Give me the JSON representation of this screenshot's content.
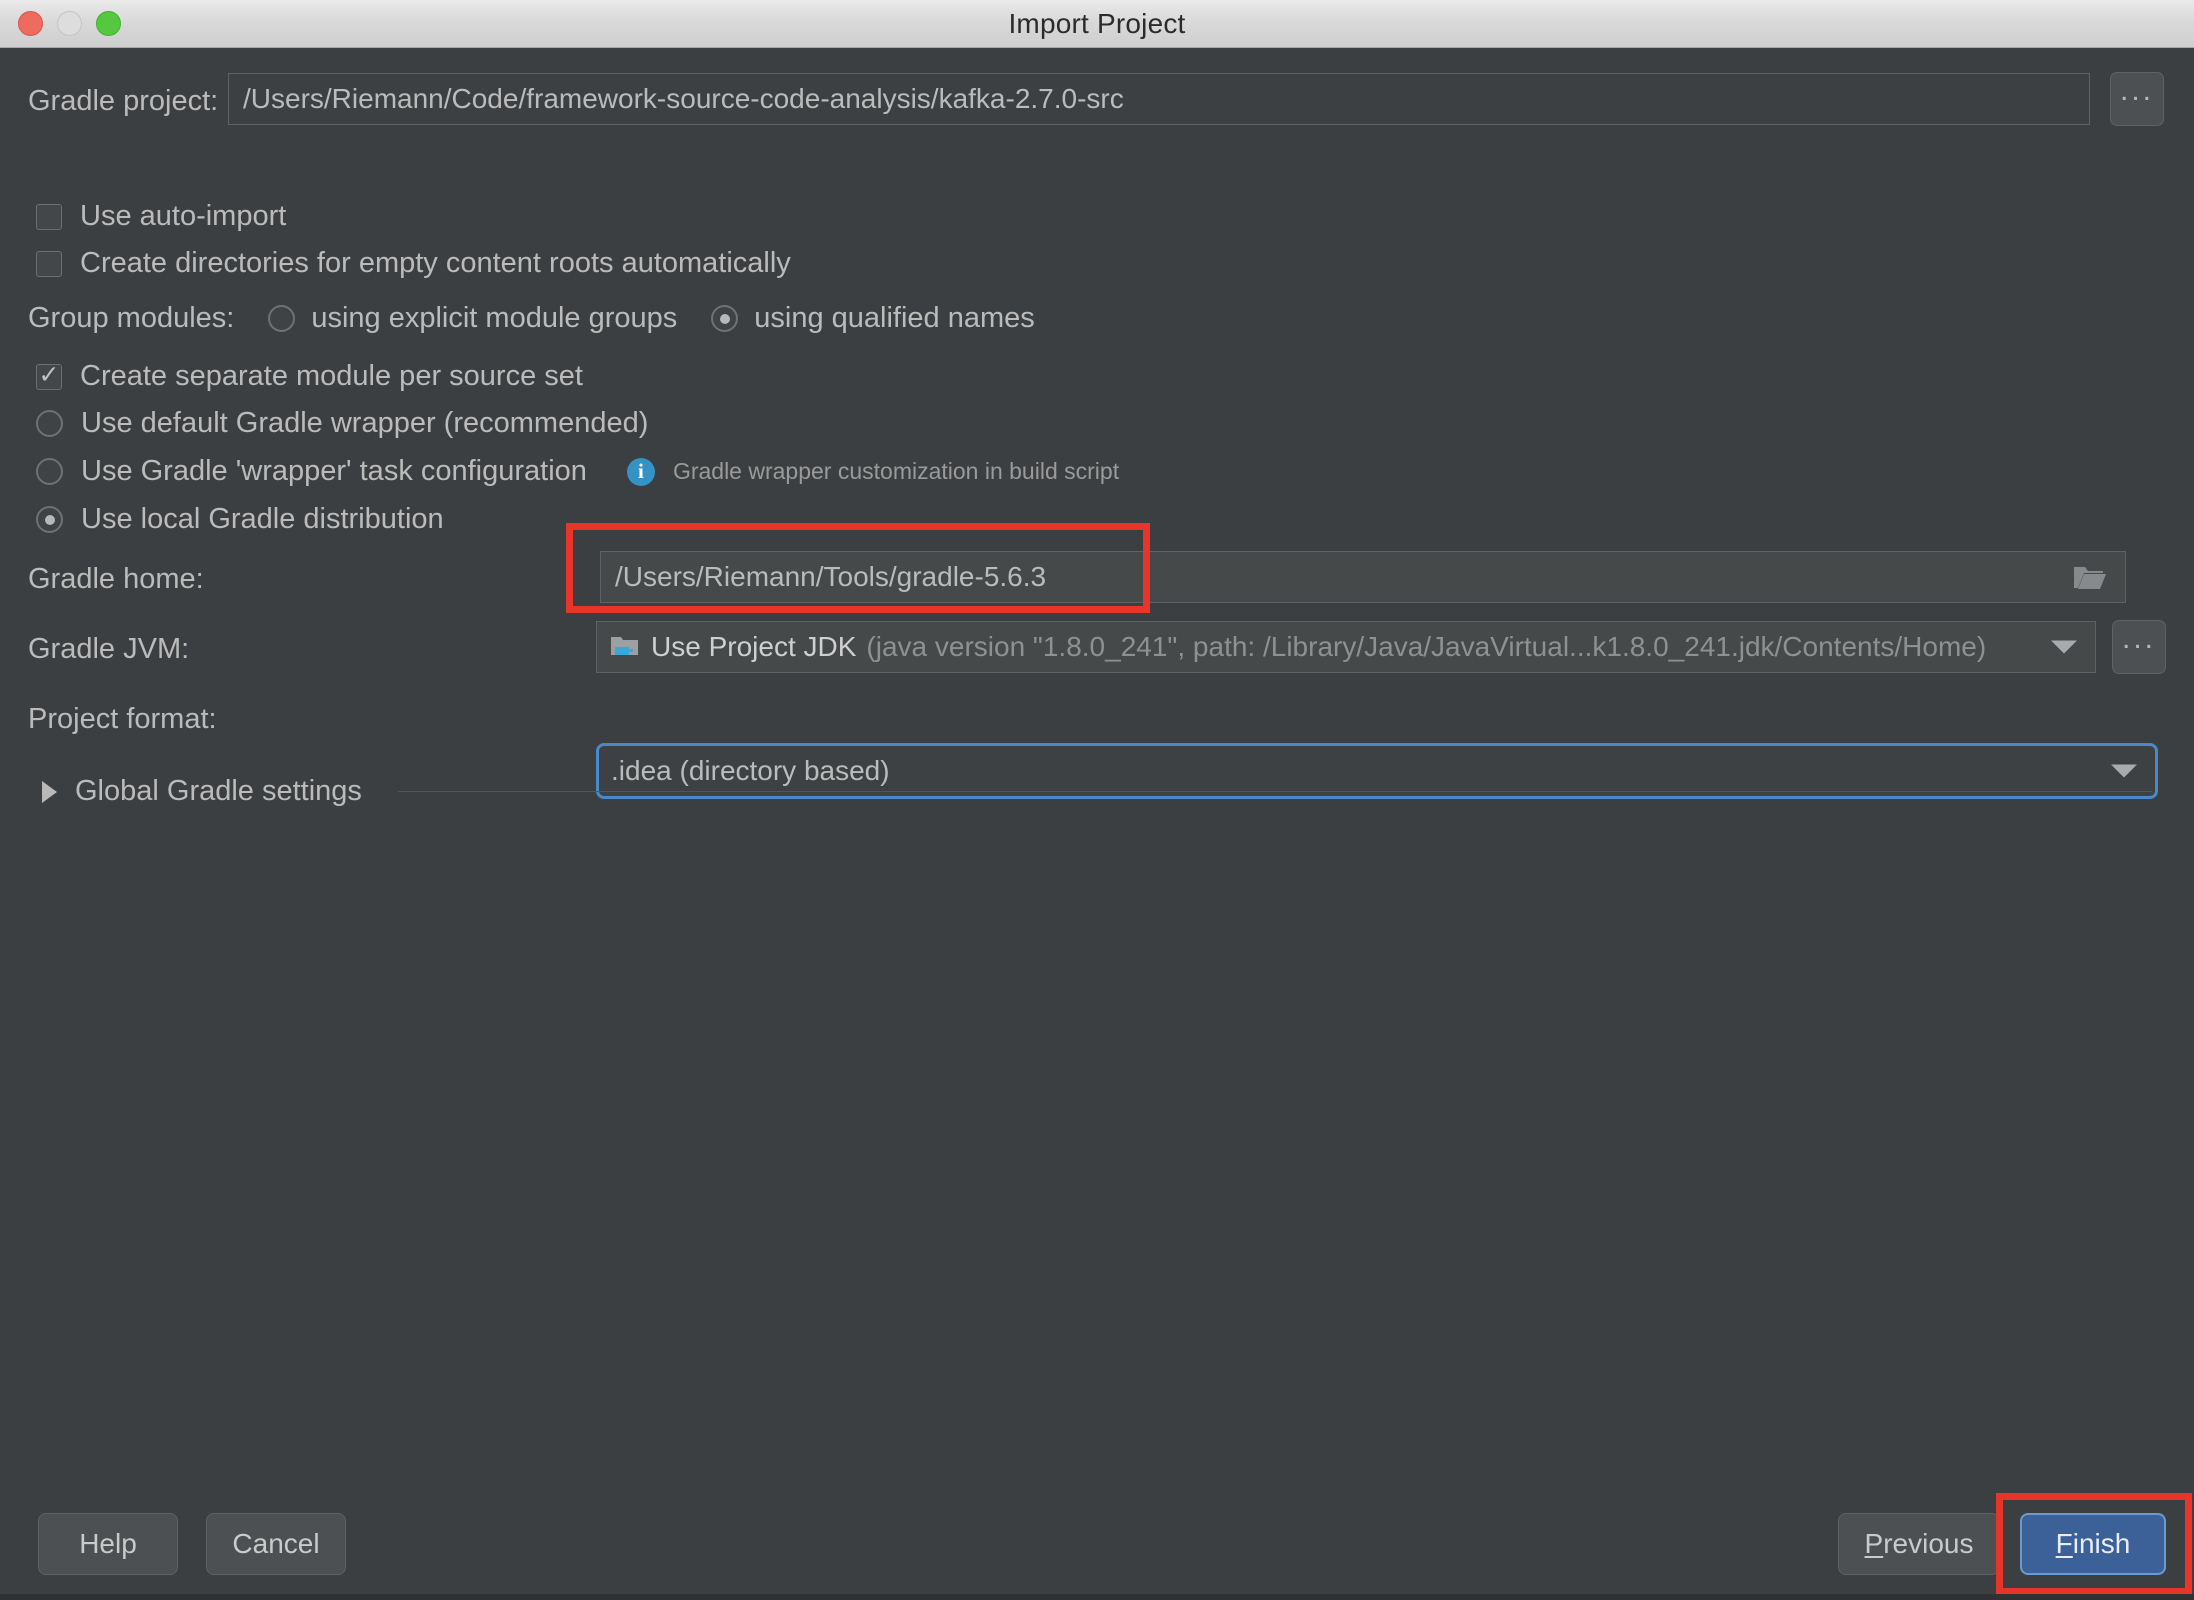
{
  "window": {
    "title": "Import Project",
    "traffic_lights": [
      "close-button",
      "minimize-button",
      "zoom-button"
    ]
  },
  "form": {
    "gradle_project": {
      "label": "Gradle project:",
      "value": "/Users/Riemann/Code/framework-source-code-analysis/kafka-2.7.0-src",
      "browse_label": "..."
    },
    "use_auto_import": {
      "label": "Use auto-import",
      "checked": false
    },
    "create_directories": {
      "label": "Create directories for empty content roots automatically",
      "checked": false
    },
    "group_modules": {
      "label": "Group modules:",
      "options": [
        {
          "label": "using explicit module groups",
          "selected": false
        },
        {
          "label": "using qualified names",
          "selected": true
        }
      ]
    },
    "create_separate_module": {
      "label": "Create separate module per source set",
      "checked": true
    },
    "distribution_options": [
      {
        "label": "Use default Gradle wrapper (recommended)",
        "selected": false
      },
      {
        "label": "Use Gradle 'wrapper' task configuration",
        "selected": false,
        "hint": "Gradle wrapper customization in build script",
        "hint_icon": "info-icon"
      },
      {
        "label": "Use local Gradle distribution",
        "selected": true
      }
    ],
    "gradle_home": {
      "label": "Gradle home:",
      "value": "/Users/Riemann/Tools/gradle-5.6.3",
      "icon": "folder-icon",
      "highlighted": true
    },
    "gradle_jvm": {
      "label": "Gradle JVM:",
      "value_main": "Use Project JDK",
      "value_sub": "(java version \"1.8.0_241\", path: /Library/Java/JavaVirtual...k1.8.0_241.jdk/Contents/Home)",
      "icon": "jdk-folder-icon",
      "browse_label": "..."
    },
    "project_format": {
      "label": "Project format:",
      "value": ".idea (directory based)",
      "focused": true
    },
    "global_gradle_settings": {
      "label": "Global Gradle settings",
      "expanded": false,
      "icon": "chevron-right-icon"
    }
  },
  "buttons": {
    "help": "Help",
    "cancel": "Cancel",
    "previous": "Previous",
    "previous_mnemonic": "P",
    "previous_rest": "revious",
    "finish": "Finish",
    "finish_mnemonic": "F",
    "finish_rest": "inish"
  },
  "colors": {
    "accent_blue": "#3c6098",
    "annotation_red": "#e8352a",
    "info_blue": "#3592c4",
    "background": "#3c3f41",
    "field_background": "#45494a"
  }
}
